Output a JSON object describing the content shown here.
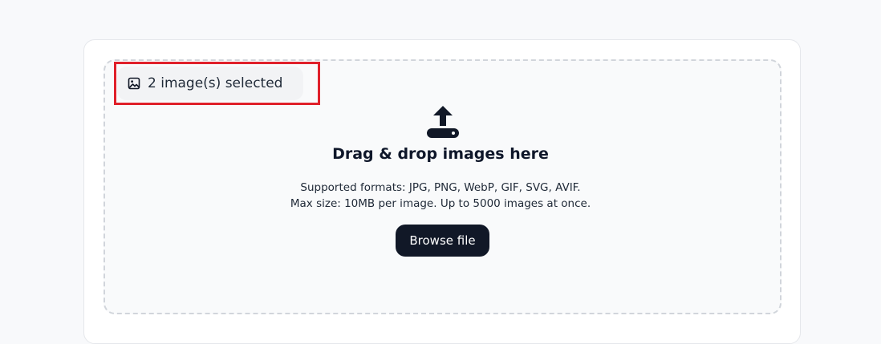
{
  "dropzone": {
    "selected_text": "2 image(s) selected",
    "title": "Drag & drop images here",
    "formats_text": "Supported formats: JPG, PNG, WebP, GIF, SVG, AVIF.",
    "limits_text": "Max size: 10MB per image. Up to 5000 images at once.",
    "browse_label": "Browse file"
  },
  "icons": {
    "selected": "image-icon",
    "upload": "upload-icon"
  },
  "colors": {
    "page_bg": "#f8f9fb",
    "button_bg": "#111827",
    "highlight": "#e0202a",
    "dash_border": "#d1d5db"
  }
}
